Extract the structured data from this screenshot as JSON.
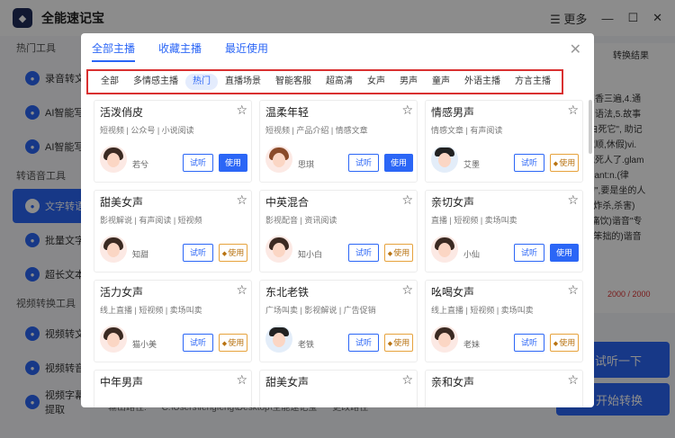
{
  "app": {
    "title": "全能速记宝",
    "logo_glyph": "◆",
    "more_label": "☰ 更多"
  },
  "sidebar": {
    "sections": [
      {
        "label": "热门工具",
        "items": [
          {
            "label": "录音转文"
          },
          {
            "label": "AI智能写"
          },
          {
            "label": "AI智能写"
          }
        ]
      },
      {
        "label": "转语音工具",
        "items": [
          {
            "label": "文字转语"
          },
          {
            "label": "批量文字"
          },
          {
            "label": "超长文本"
          }
        ]
      },
      {
        "label": "视频转换工具",
        "items": [
          {
            "label": "视频转文"
          },
          {
            "label": "视频转音"
          },
          {
            "label": "视频字幕提取"
          }
        ]
      }
    ]
  },
  "right_panel": {
    "header": "转换结果",
    "lines": [
      "真香三遍,4.通",
      "用语法,5.故事",
      "\"白死它\", 助记",
      "飕顺,休假)vi.",
      "饿死人了.glam",
      "licant:n.(律",
      "的\",要是坐的人",
      "x(炸杀,杀害)",
      "!,痛饮)谐音\"专",
      "h,笨拙的)谐音"
    ],
    "count": "2000 / 2000"
  },
  "actions": {
    "listen": "试听一下",
    "convert": "开始转换"
  },
  "output": {
    "label": "输出路径:",
    "path": "C:\\Users\\fengfeng\\Desktop\\全能速记宝",
    "change": "更改路径"
  },
  "modal": {
    "tabs": [
      {
        "label": "全部主播"
      },
      {
        "label": "收藏主播"
      },
      {
        "label": "最近使用"
      }
    ],
    "close_glyph": "✕",
    "filters": [
      "全部",
      "多情感主播",
      "热门",
      "直播场景",
      "智能客服",
      "超高清",
      "女声",
      "男声",
      "童声",
      "外语主播",
      "方言主播"
    ],
    "active_filter": "热门",
    "try_label": "试听",
    "use_label": "使用",
    "vip_label": "使用",
    "cards": [
      {
        "name": "活泼俏皮",
        "tags": "短视频 | 公众号 | 小说阅读",
        "voice": "若兮",
        "vip": false,
        "avatar": "f"
      },
      {
        "name": "温柔年轻",
        "tags": "短视频 | 产品介绍 | 情感文章",
        "voice": "思琪",
        "vip": false,
        "avatar": "fb"
      },
      {
        "name": "情感男声",
        "tags": "情感文章 | 有声阅读",
        "voice": "艾墨",
        "vip": true,
        "avatar": "m"
      },
      {
        "name": "甜美女声",
        "tags": "影视解说 | 有声阅读 | 短视频",
        "voice": "知甜",
        "vip": true,
        "avatar": "f"
      },
      {
        "name": "中英混合",
        "tags": "影视配音 | 资讯阅读",
        "voice": "知小白",
        "vip": true,
        "avatar": "f"
      },
      {
        "name": "亲切女声",
        "tags": "直播 | 短视频 | 卖场叫卖",
        "voice": "小仙",
        "vip": false,
        "avatar": "f"
      },
      {
        "name": "活力女声",
        "tags": "线上直播 | 短视频 | 卖场叫卖",
        "voice": "猫小美",
        "vip": true,
        "avatar": "f"
      },
      {
        "name": "东北老铁",
        "tags": "广场叫卖 | 影视解说 | 广告促销",
        "voice": "老铁",
        "vip": true,
        "avatar": "m"
      },
      {
        "name": "吆喝女声",
        "tags": "线上直播 | 短视频 | 卖场叫卖",
        "voice": "老妹",
        "vip": true,
        "avatar": "f"
      },
      {
        "name": "中年男声",
        "tags": "",
        "voice": "",
        "vip": false,
        "avatar": "m"
      },
      {
        "name": "甜美女声",
        "tags": "",
        "voice": "",
        "vip": false,
        "avatar": "f"
      },
      {
        "name": "亲和女声",
        "tags": "",
        "voice": "",
        "vip": false,
        "avatar": "f"
      }
    ]
  }
}
